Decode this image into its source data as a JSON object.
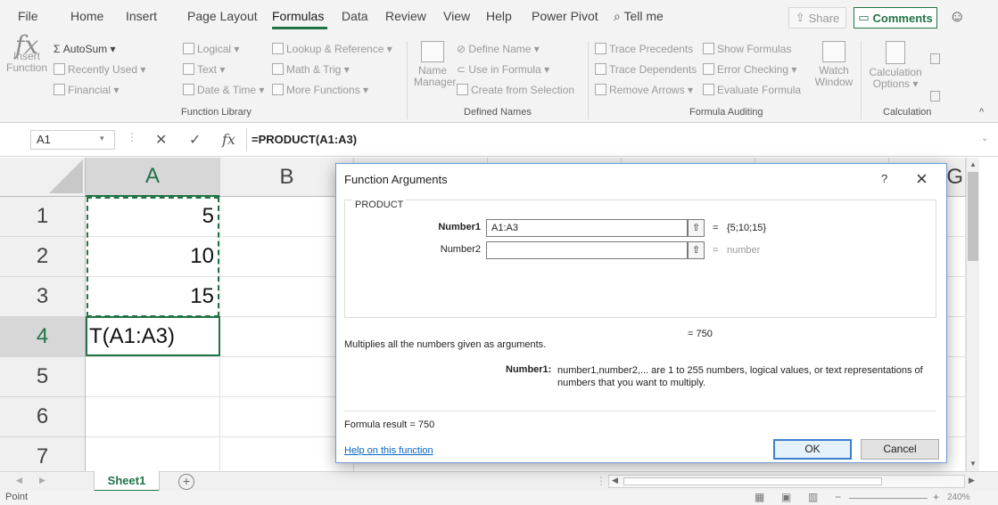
{
  "menu": {
    "items": [
      "File",
      "Home",
      "Insert",
      "Page Layout",
      "Formulas",
      "Data",
      "Review",
      "View",
      "Help",
      "Power Pivot"
    ],
    "active": "Formulas",
    "tell_me": "Tell me",
    "share": "Share",
    "comments": "Comments"
  },
  "ribbon": {
    "insert_function": [
      "Insert",
      "Function"
    ],
    "autosum": "AutoSum",
    "recently_used": "Recently Used",
    "financial": "Financial",
    "logical": "Logical",
    "text": "Text",
    "date_time": "Date & Time",
    "lookup": "Lookup & Reference",
    "math": "Math & Trig",
    "more": "More Functions",
    "name_manager": [
      "Name",
      "Manager"
    ],
    "define_name": "Define Name",
    "use_in_formula": "Use in Formula",
    "create_from_selection": "Create from Selection",
    "trace_precedents": "Trace Precedents",
    "trace_dependents": "Trace Dependents",
    "remove_arrows": "Remove Arrows",
    "show_formulas": "Show Formulas",
    "error_checking": "Error Checking",
    "evaluate_formula": "Evaluate Formula",
    "watch_window": [
      "Watch",
      "Window"
    ],
    "calc_options": [
      "Calculation",
      "Options"
    ],
    "groups": {
      "function_library": "Function Library",
      "defined_names": "Defined Names",
      "formula_auditing": "Formula Auditing",
      "calculation": "Calculation"
    }
  },
  "formula_bar": {
    "name_box": "A1",
    "formula": "=PRODUCT(A1:A3)"
  },
  "grid": {
    "columns": [
      "A",
      "B",
      "G"
    ],
    "rows": [
      "1",
      "2",
      "3",
      "4",
      "5",
      "6",
      "7"
    ],
    "a1": "5",
    "a2": "10",
    "a3": "15",
    "a4": "T(A1:A3)"
  },
  "sheet_tab": "Sheet1",
  "status": "Point",
  "zoom": "240%",
  "dialog": {
    "title": "Function Arguments",
    "function_name": "PRODUCT",
    "arg1_label": "Number1",
    "arg1_value": "A1:A3",
    "arg1_result": "{5;10;15}",
    "arg2_label": "Number2",
    "arg2_value": "",
    "arg2_result": "number",
    "result": "750",
    "description": "Multiplies all the numbers given as arguments.",
    "arg_desc_label": "Number1:",
    "arg_desc_text": "number1,number2,... are 1 to 255 numbers, logical values, or text representations of numbers that you want to multiply.",
    "formula_result_label": "Formula result =",
    "formula_result_value": "750",
    "help_link": "Help on this function",
    "ok": "OK",
    "cancel": "Cancel"
  }
}
